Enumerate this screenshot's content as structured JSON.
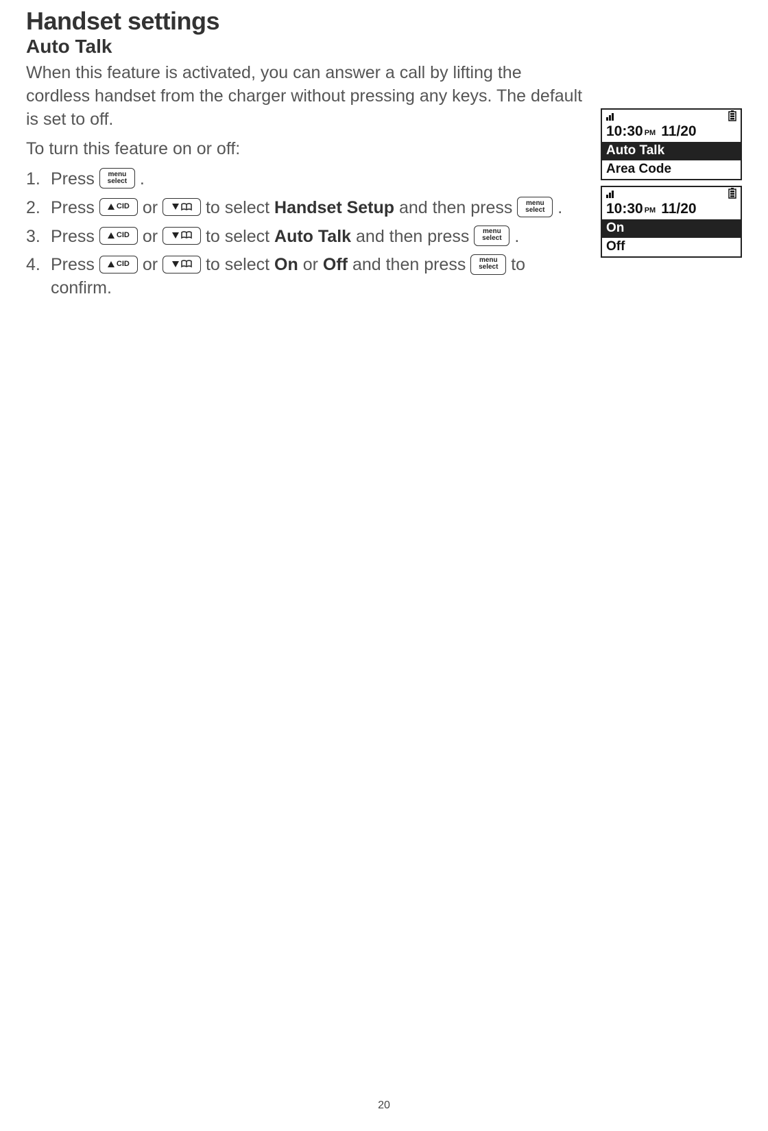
{
  "title": "Handset settings",
  "subtitle": "Auto Talk",
  "intro": "When this feature is activated, you can answer a call by lifting the cordless handset from the charger without pressing any keys. The default is set to off.",
  "prompt": "To turn this feature on or off:",
  "steps": {
    "s1_a": "Press ",
    "s1_b": ".",
    "s2_a": "Press ",
    "s2_b": " or ",
    "s2_c": " to select ",
    "s2_kw": "Handset Setup",
    "s2_d": " and then press ",
    "s2_e": ".",
    "s3_a": "Press ",
    "s3_b": " or ",
    "s3_c": " to select ",
    "s3_kw": "Auto Talk",
    "s3_d": " and then press ",
    "s3_e": ".",
    "s4_a": "Press ",
    "s4_b": " or ",
    "s4_c": " to select ",
    "s4_kw1": "On",
    "s4_mid": " or ",
    "s4_kw2": "Off",
    "s4_d": " and then press ",
    "s4_e": " to confirm."
  },
  "key_labels": {
    "menu_top": "menu",
    "menu_bot": "select",
    "cid": "CID"
  },
  "screens": [
    {
      "time": "10:30",
      "ampm": "PM",
      "date": "11/20",
      "rows": [
        {
          "label": "Auto Talk",
          "selected": true
        },
        {
          "label": "Area Code",
          "selected": false
        }
      ]
    },
    {
      "time": "10:30",
      "ampm": "PM",
      "date": "11/20",
      "rows": [
        {
          "label": "On",
          "selected": true
        },
        {
          "label": "Off",
          "selected": false
        }
      ]
    }
  ],
  "page_number": "20"
}
